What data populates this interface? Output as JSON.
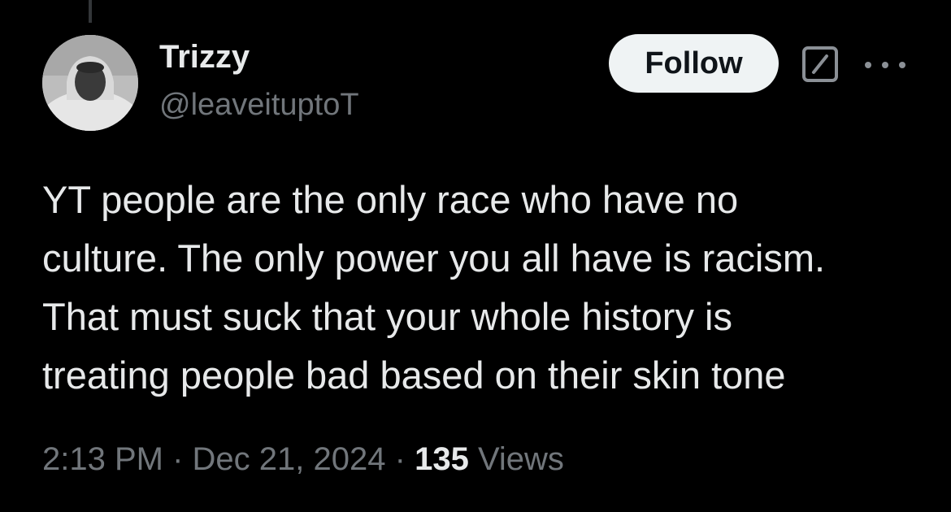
{
  "user": {
    "name": "Trizzy",
    "handle": "@leaveituptoT"
  },
  "actions": {
    "follow_label": "Follow"
  },
  "tweet": {
    "text": "YT people are the only race who have no\nculture. The only power you all have is racism.\nThat must suck that your whole history is\ntreating people bad based on their skin tone"
  },
  "meta": {
    "time": "2:13 PM",
    "separator": "·",
    "date": "Dec 21, 2024",
    "views_count": "135",
    "views_label": "Views"
  },
  "icons": {
    "avatar": "avatar-photo",
    "grok": "grok-icon",
    "more": "more-icon"
  },
  "colors": {
    "background": "#000000",
    "primary_text": "#e7e9ea",
    "secondary_text": "#71767b",
    "follow_bg": "#eff3f4",
    "follow_text": "#0f1419"
  }
}
